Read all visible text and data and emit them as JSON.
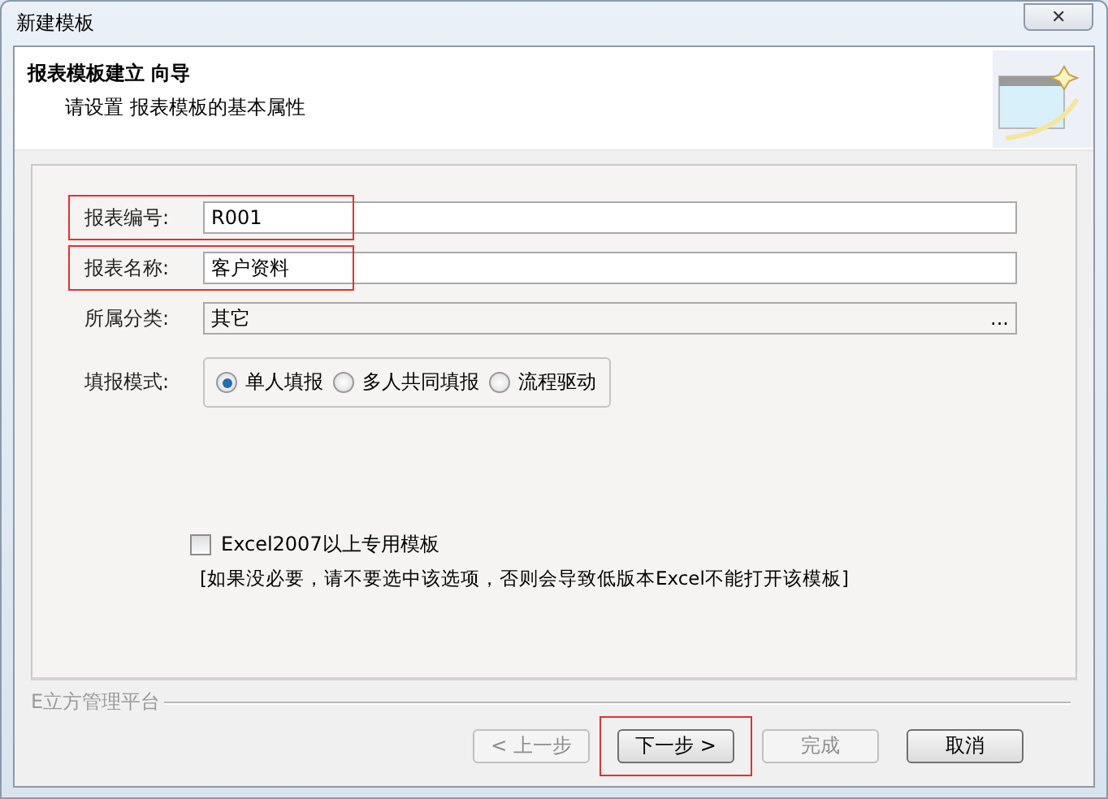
{
  "window": {
    "title": "新建模板",
    "close": "✕"
  },
  "header": {
    "title": "报表模板建立 向导",
    "subtitle": "请设置 报表模板的基本属性"
  },
  "fields": [
    {
      "kind": "text",
      "label": "报表编号:",
      "value": "R001",
      "highlighted": true
    },
    {
      "kind": "text",
      "label": "报表名称:",
      "value": "客户资料",
      "highlighted": true
    },
    {
      "kind": "picker",
      "label": "所属分类:",
      "value": "其它",
      "button": "...",
      "highlighted": false
    }
  ],
  "mode": {
    "label": "填报模式:",
    "options": [
      {
        "label": "单人填报",
        "selected": true
      },
      {
        "label": "多人共同填报",
        "selected": false
      },
      {
        "label": "流程驱动",
        "selected": false
      }
    ]
  },
  "excel_option": {
    "label": "Excel2007以上专用模板",
    "checked": false,
    "note": "[如果没必要，请不要选中该选项，否则会导致低版本Excel不能打开该模板]"
  },
  "footer_group": "E立方管理平台",
  "buttons": [
    {
      "label": "< 上一步",
      "disabled": true,
      "highlighted": false
    },
    {
      "label": "下一步 >",
      "disabled": false,
      "highlighted": true
    },
    {
      "label": "完成",
      "disabled": true,
      "highlighted": false
    },
    {
      "label": "取消",
      "disabled": false,
      "highlighted": false
    }
  ]
}
